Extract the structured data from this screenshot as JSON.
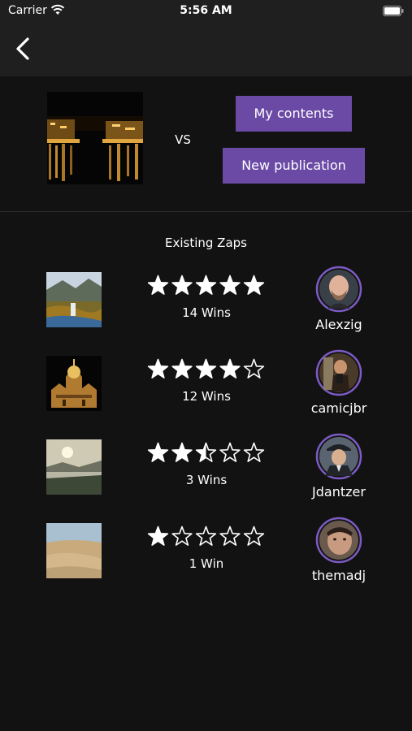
{
  "status_bar": {
    "carrier": "Carrier",
    "time": "5:56 AM",
    "wifi_icon": "wifi-icon",
    "battery_icon": "battery-icon"
  },
  "nav": {
    "back_icon": "chevron-left-icon"
  },
  "compare": {
    "vs_label": "VS",
    "my_contents_label": "My contents",
    "new_publication_label": "New publication"
  },
  "zaps": {
    "title": "Existing Zaps",
    "items": [
      {
        "rating": 5,
        "wins": "14 Wins",
        "username": "Alexzig",
        "thumb": "waterfall-landscape-photo",
        "avatar": "bald-man-avatar"
      },
      {
        "rating": 4,
        "wins": "12 Wins",
        "username": "camicjbr",
        "thumb": "cathedral-night-photo",
        "avatar": "mirror-selfie-avatar"
      },
      {
        "rating": 2.5,
        "wins": "3 Wins",
        "username": "Jdantzer",
        "thumb": "sunset-lake-photo",
        "avatar": "flat-cap-man-avatar"
      },
      {
        "rating": 1,
        "wins": "1 Win",
        "username": "themadj",
        "thumb": "desert-dunes-photo",
        "avatar": "man-face-closeup-avatar"
      }
    ]
  },
  "colors": {
    "background": "#121212",
    "bar": "#1f1f1f",
    "accent": "#6b4aa6",
    "avatar_ring": "#7b5bc4"
  }
}
